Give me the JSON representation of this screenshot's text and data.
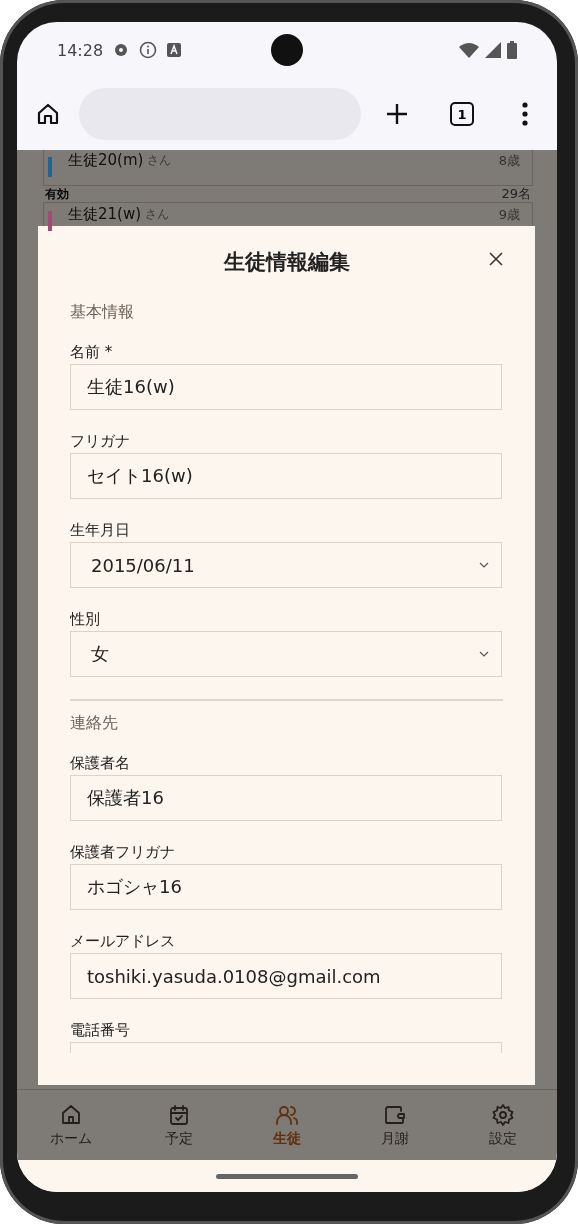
{
  "status_bar": {
    "time": "14:28"
  },
  "browser": {
    "tab_count": "1"
  },
  "background_list": {
    "rows": [
      {
        "name": "生徒20(m)",
        "suffix": "さん",
        "age": "8歳",
        "color": "#1f6690"
      },
      {
        "name": "生徒21(w)",
        "suffix": "さん",
        "age": "9歳",
        "color": "#a04a74"
      }
    ],
    "group_header": {
      "label": "有効",
      "count": "29名"
    }
  },
  "dialog": {
    "title": "生徒情報編集",
    "sections": [
      {
        "heading": "基本情報",
        "fields": [
          {
            "label": "名前 *",
            "kind": "text",
            "value": "生徒16(w)"
          },
          {
            "label": "フリガナ",
            "kind": "text",
            "value": "セイト16(w)"
          },
          {
            "label": "生年月日",
            "kind": "select",
            "value": "2015/06/11"
          },
          {
            "label": "性別",
            "kind": "select",
            "value": "女"
          }
        ]
      },
      {
        "heading": "連絡先",
        "fields": [
          {
            "label": "保護者名",
            "kind": "text",
            "value": "保護者16"
          },
          {
            "label": "保護者フリガナ",
            "kind": "text",
            "value": "ホゴシャ16"
          },
          {
            "label": "メールアドレス",
            "kind": "text",
            "value": "toshiki.yasuda.0108@gmail.com"
          },
          {
            "label": "電話番号",
            "kind": "text"
          }
        ]
      }
    ]
  },
  "bottom_nav": [
    {
      "label": "ホーム",
      "selected": false
    },
    {
      "label": "予定",
      "selected": false
    },
    {
      "label": "生徒",
      "selected": true
    },
    {
      "label": "月謝",
      "selected": false
    },
    {
      "label": "設定",
      "selected": false
    }
  ]
}
